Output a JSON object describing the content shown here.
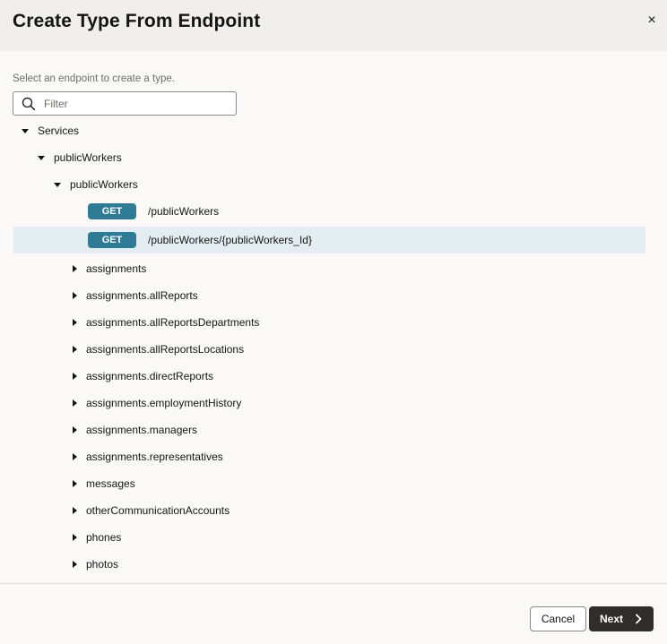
{
  "dialog": {
    "title": "Create Type From Endpoint",
    "close_label": "×"
  },
  "main": {
    "instructions": "Select an endpoint to create a type.",
    "filter": {
      "placeholder": "Filter",
      "value": ""
    }
  },
  "tree": {
    "services_label": "Services",
    "service_label": "publicWorkers",
    "resource_label": "publicWorkers",
    "endpoints": [
      {
        "method": "GET",
        "path": "/publicWorkers",
        "selected": false
      },
      {
        "method": "GET",
        "path": "/publicWorkers/{publicWorkers_Id}",
        "selected": true
      }
    ],
    "children": [
      "assignments",
      "assignments.allReports",
      "assignments.allReportsDepartments",
      "assignments.allReportsLocations",
      "assignments.directReports",
      "assignments.employmentHistory",
      "assignments.managers",
      "assignments.representatives",
      "messages",
      "otherCommunicationAccounts",
      "phones",
      "photos"
    ]
  },
  "footer": {
    "cancel_label": "Cancel",
    "next_label": "Next"
  },
  "colors": {
    "badge": "#2f7b96",
    "selected_row": "#e4eef2",
    "primary_button": "#312d2a",
    "header": "#f1efed"
  },
  "icons": {
    "filter": "search-icon",
    "close": "close-icon",
    "expanded": "caret-down-icon",
    "collapsed": "caret-right-icon",
    "next": "chevron-right-icon"
  }
}
